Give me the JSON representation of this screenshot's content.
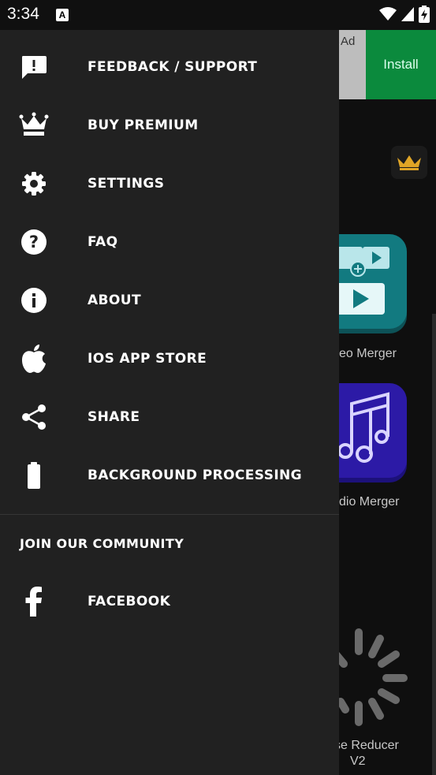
{
  "status_bar": {
    "time": "3:34",
    "notification_badge": "A"
  },
  "background_app": {
    "ad": {
      "label": "Ad",
      "install_label": "Install"
    },
    "tiles": [
      {
        "label": "eo Merger"
      },
      {
        "label": "dio Merger"
      }
    ],
    "noise_reducer": {
      "line1": "se Reducer",
      "line2": "V2"
    },
    "colors": {
      "merger_tile": "#127a80",
      "audio_tile": "#2c1aa6",
      "install": "#0b8a3d"
    }
  },
  "drawer": {
    "items": [
      {
        "label": "FEEDBACK / SUPPORT",
        "icon": "feedback-icon"
      },
      {
        "label": "BUY PREMIUM",
        "icon": "crown-icon"
      },
      {
        "label": "SETTINGS",
        "icon": "gear-icon"
      },
      {
        "label": "FAQ",
        "icon": "help-icon"
      },
      {
        "label": "ABOUT",
        "icon": "info-icon"
      },
      {
        "label": "IOS APP STORE",
        "icon": "apple-icon"
      },
      {
        "label": "SHARE",
        "icon": "share-icon"
      },
      {
        "label": "BACKGROUND PROCESSING",
        "icon": "battery-icon"
      }
    ],
    "community": {
      "title": "JOIN OUR COMMUNITY",
      "items": [
        {
          "label": "FACEBOOK",
          "icon": "facebook-icon"
        }
      ]
    }
  }
}
